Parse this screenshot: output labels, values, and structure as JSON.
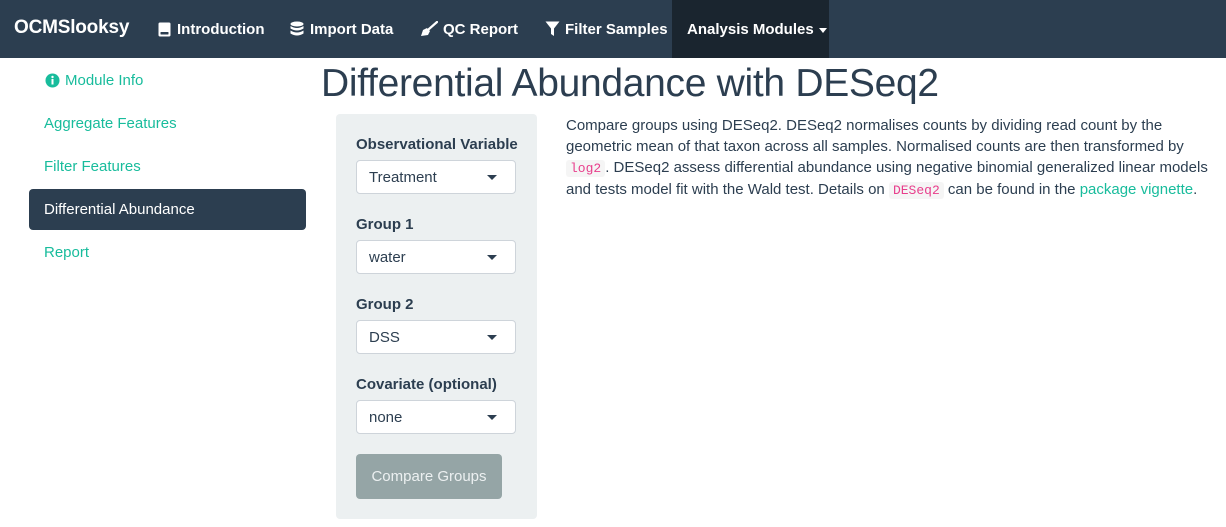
{
  "navbar": {
    "brand": "OCMSlooksy",
    "items": [
      {
        "label": "Introduction",
        "icon": "book-icon"
      },
      {
        "label": "Import Data",
        "icon": "database-icon"
      },
      {
        "label": "QC Report",
        "icon": "broom-icon"
      },
      {
        "label": "Filter Samples",
        "icon": "filter-icon"
      },
      {
        "label": "Analysis Modules",
        "icon": "caret-down-icon"
      }
    ]
  },
  "sidebar": {
    "items": [
      {
        "label": "Module Info",
        "icon": "info-circle-icon"
      },
      {
        "label": "Aggregate Features"
      },
      {
        "label": "Filter Features"
      },
      {
        "label": "Differential Abundance"
      },
      {
        "label": "Report"
      }
    ]
  },
  "page": {
    "title": "Differential Abundance with DESeq2"
  },
  "form": {
    "observational_variable": {
      "label": "Observational Variable",
      "value": "Treatment"
    },
    "group1": {
      "label": "Group 1",
      "value": "water"
    },
    "group2": {
      "label": "Group 2",
      "value": "DSS"
    },
    "covariate": {
      "label": "Covariate (optional)",
      "value": "none"
    },
    "compare_button": "Compare Groups"
  },
  "description": {
    "part1": "Compare groups using DESeq2. DESeq2 normalises counts by dividing read count by the geometric mean of that taxon across all samples. Normalised counts are then transformed by ",
    "code1": "log2",
    "part2": ". DESeq2 assess differential abundance using negative binomial generalized linear models and tests model fit with the Wald test. Details on ",
    "code2": "DESeq2",
    "part3": " can be found in the ",
    "link": "package vignette",
    "part4": "."
  },
  "colors": {
    "navbar_bg": "#2c3e50",
    "navbar_active": "#1a252f",
    "accent": "#18bc9c",
    "well_bg": "#ecf0f1",
    "button_bg": "#95a5a6",
    "code_color": "#e83e8c"
  }
}
